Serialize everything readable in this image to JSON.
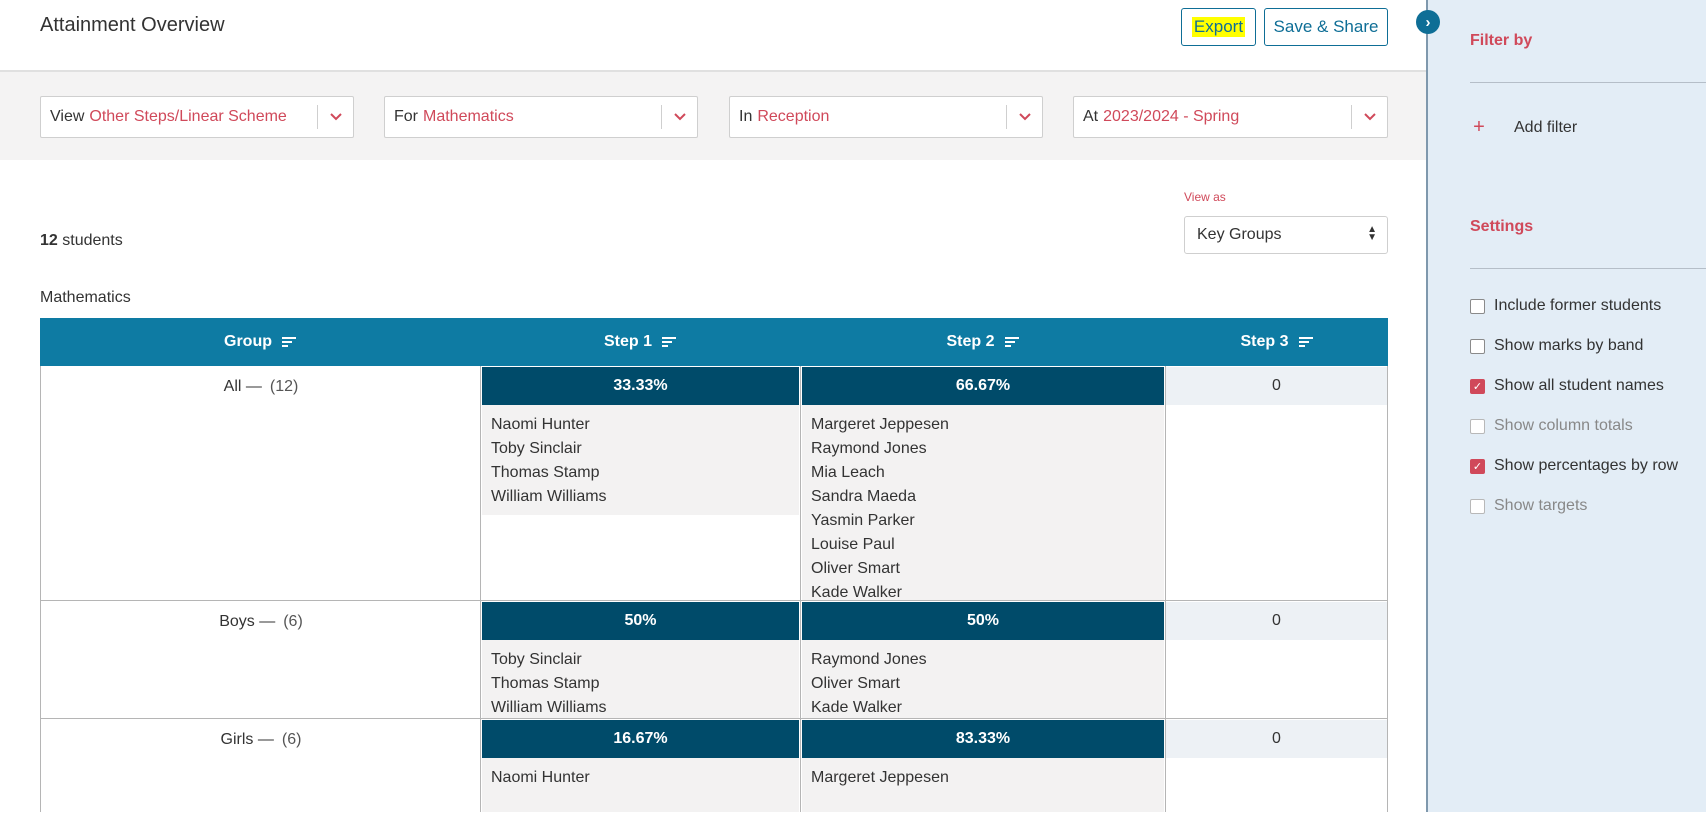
{
  "header": {
    "title": "Attainment Overview",
    "export_label": "Export",
    "share_label": "Save & Share",
    "collapse_icon": "chevron-right-icon"
  },
  "filters": [
    {
      "prefix": "View",
      "value": "Other Steps/Linear Scheme"
    },
    {
      "prefix": "For",
      "value": "Mathematics"
    },
    {
      "prefix": "In",
      "value": "Reception"
    },
    {
      "prefix": "At",
      "value": "2023/2024 - Spring"
    }
  ],
  "view_as": {
    "label": "View as",
    "selected": "Key Groups"
  },
  "summary": {
    "count": "12",
    "count_suffix": "students",
    "subject": "Mathematics"
  },
  "table": {
    "headers": [
      "Group",
      "Step 1",
      "Step 2",
      "Step 3"
    ],
    "rows": [
      {
        "group": "All —",
        "count": "(12)",
        "step1_pct": "33.33%",
        "step1_names": [
          "Naomi Hunter",
          "Toby Sinclair",
          "Thomas Stamp",
          "William Williams"
        ],
        "step2_pct": "66.67%",
        "step2_names": [
          "Margeret Jeppesen",
          "Raymond Jones",
          "Mia Leach",
          "Sandra Maeda",
          "Yasmin Parker",
          "Louise Paul",
          "Oliver Smart",
          "Kade Walker"
        ],
        "step3": "0"
      },
      {
        "group": "Boys —",
        "count": "(6)",
        "step1_pct": "50%",
        "step1_names": [
          "Toby Sinclair",
          "Thomas Stamp",
          "William Williams"
        ],
        "step2_pct": "50%",
        "step2_names": [
          "Raymond Jones",
          "Oliver Smart",
          "Kade Walker"
        ],
        "step3": "0"
      },
      {
        "group": "Girls —",
        "count": "(6)",
        "step1_pct": "16.67%",
        "step1_names": [
          "Naomi Hunter"
        ],
        "step2_pct": "83.33%",
        "step2_names": [
          "Margeret Jeppesen"
        ],
        "step3": "0"
      }
    ]
  },
  "sidebar": {
    "filter_title": "Filter by",
    "add_filter": "Add filter",
    "settings_title": "Settings",
    "settings": [
      {
        "label": "Include former students",
        "checked": false,
        "disabled": false
      },
      {
        "label": "Show marks by band",
        "checked": false,
        "disabled": false
      },
      {
        "label": "Show all student names",
        "checked": true,
        "disabled": false
      },
      {
        "label": "Show column totals",
        "checked": false,
        "disabled": true
      },
      {
        "label": "Show percentages by row",
        "checked": true,
        "disabled": false
      },
      {
        "label": "Show targets",
        "checked": false,
        "disabled": true
      }
    ]
  },
  "colors": {
    "accent": "#d0495a",
    "header_blue": "#0e7ba3",
    "pct_dark": "#004b6a",
    "sidebar_bg": "#e3edf6",
    "highlight": "#ffff00"
  }
}
